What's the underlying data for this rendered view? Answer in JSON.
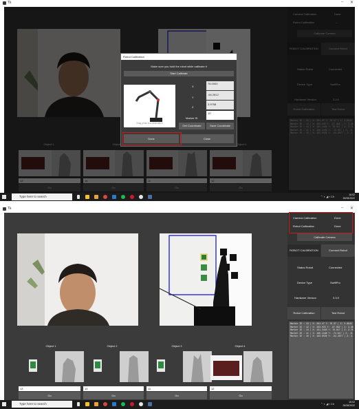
{
  "window": {
    "title": "Tk",
    "minimize": "–",
    "close": "✕"
  },
  "objects": [
    {
      "label": "Object 1",
      "value": "13",
      "go": "Go"
    },
    {
      "label": "Object 2",
      "value": "14",
      "go": "Go"
    },
    {
      "label": "Object 3",
      "value": "11",
      "go": "Go"
    },
    {
      "label": "Object 4",
      "value": "12",
      "go": "Go"
    }
  ],
  "sidebar": {
    "camera_calibration": "Camera Calibration",
    "camera_status": "Done",
    "robot_calibration": "Robot Calibration",
    "robot_status_top": "--",
    "robot_status_bottom": "Done",
    "calibrate_camera": "Calibrate Camera",
    "robot_calibration_btn": "ROBOT CALIBRATION",
    "connect_robot": "Connect Robot",
    "status_robot": "Status Robot",
    "status_robot_value": "Connected",
    "device_type": "Device Type",
    "device_type_value": "SwiftPro",
    "hardware_version": "Hardware Version",
    "hardware_version_value": "3.3.0",
    "robot_calibration_bottom": "Robot Calibration",
    "test_robot": "Test Robot",
    "log": "Marker ID : 13 | X: 281.47 Y: 76.37 | Z: 3.8641\nMarker ID : 12 | X: 283.025 Y: -67.892 | Z: 3.4661\nMarker ID : 14 | X: 191.3428 Y: 78.917 | Z: 3.7524\nMarker ID : 11 | X: 196.1188 Y: -74.617 | Z: -0.4725\nMarker ID : 10 | X: 193.0535 Y: -94.2877 | Z: 2.0075"
  },
  "dialog": {
    "title": "Robot Calibration",
    "instruction": "Make sure you hold the robot while calibrate it",
    "start_button": "Start Calibrate",
    "x_label": "X",
    "y_label": "Y",
    "z_label": "Z",
    "x_value": "76.0000",
    "y_value": "-64.2812",
    "z_value": "3.9758",
    "marker_label": "Marker ID",
    "marker_value": "10",
    "image_caption": "Drag photo to a destination",
    "get_coordinate": "Get Coordinate",
    "save_coordinate": "Save Coordinate",
    "done": "Done",
    "close": "Close"
  },
  "taskbar": {
    "search_placeholder": "Type here to search",
    "time": "16:02",
    "date": "26/08/2022"
  },
  "colors": {
    "highlight": "#d01818",
    "app_bg": "#3b3b3b",
    "button": "#5a5a5a"
  }
}
